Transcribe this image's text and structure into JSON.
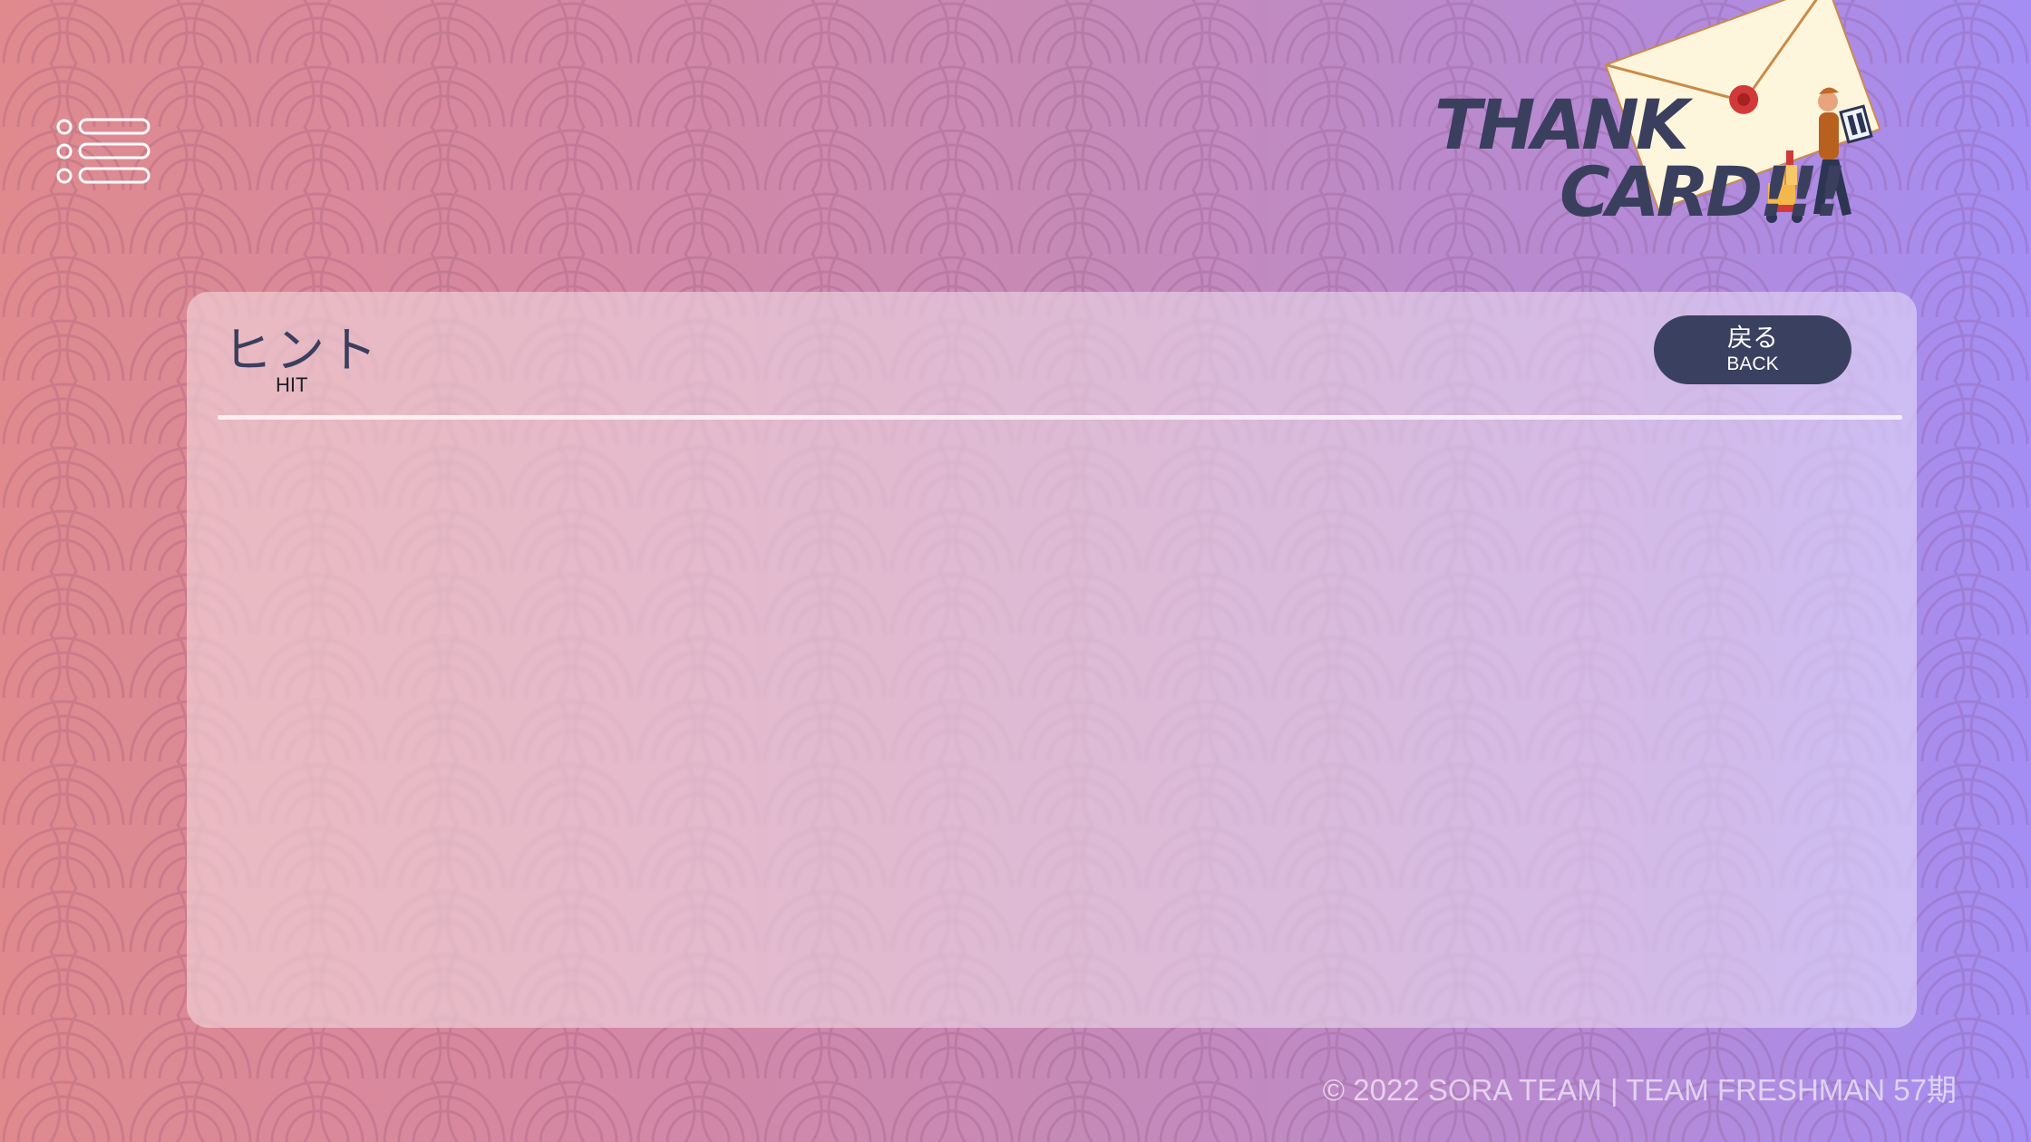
{
  "header": {
    "menu_icon": "list-menu-icon",
    "logo": {
      "line1": "THANK",
      "line2": "CARD!!!",
      "illustration": "envelope-delivery-person-icon"
    }
  },
  "panel": {
    "title": "ヒント",
    "subtitle": "HIT",
    "back_button": {
      "label": "戻る",
      "sublabel": "BACK"
    }
  },
  "footer": {
    "copyright": "© 2022 SORA TEAM | TEAM FRESHMAN 57期"
  },
  "colors": {
    "accent_dark": "#3a4060",
    "gradient_start": "#e08a8e",
    "gradient_end": "#a48ef4"
  }
}
